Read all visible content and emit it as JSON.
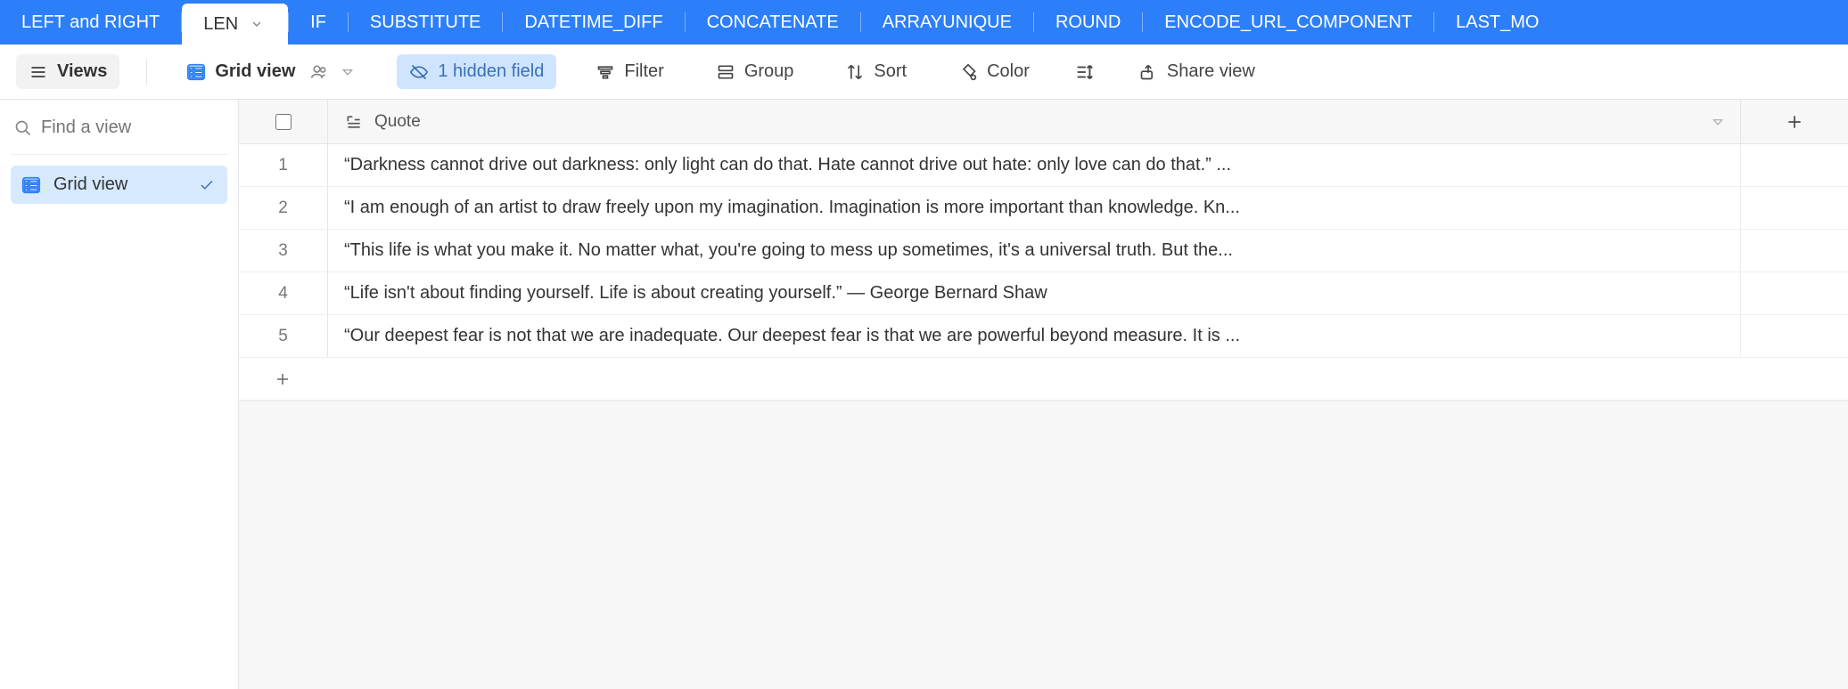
{
  "tabs": [
    {
      "label": "LEFT and RIGHT",
      "active": false
    },
    {
      "label": "LEN",
      "active": true
    },
    {
      "label": "IF",
      "active": false
    },
    {
      "label": "SUBSTITUTE",
      "active": false
    },
    {
      "label": "DATETIME_DIFF",
      "active": false
    },
    {
      "label": "CONCATENATE",
      "active": false
    },
    {
      "label": "ARRAYUNIQUE",
      "active": false
    },
    {
      "label": "ROUND",
      "active": false
    },
    {
      "label": "ENCODE_URL_COMPONENT",
      "active": false
    },
    {
      "label": "LAST_MO",
      "active": false
    }
  ],
  "toolbar": {
    "views": "Views",
    "grid_view": "Grid view",
    "hidden_field": "1 hidden field",
    "filter": "Filter",
    "group": "Group",
    "sort": "Sort",
    "color": "Color",
    "share": "Share view"
  },
  "sidebar": {
    "search_placeholder": "Find a view",
    "views": [
      {
        "label": "Grid view",
        "active": true
      }
    ]
  },
  "grid": {
    "column_header": "Quote",
    "rows": [
      {
        "n": "1",
        "text": "“Darkness cannot drive out darkness: only light can do that. Hate cannot drive out hate: only love can do that.” ..."
      },
      {
        "n": "2",
        "text": "“I am enough of an artist to draw freely upon my imagination. Imagination is more important than knowledge. Kn..."
      },
      {
        "n": "3",
        "text": "“This life is what you make it. No matter what, you're going to mess up sometimes, it's a universal truth. But the..."
      },
      {
        "n": "4",
        "text": "“Life isn't about finding yourself. Life is about creating yourself.” ― George Bernard Shaw"
      },
      {
        "n": "5",
        "text": "“Our deepest fear is not that we are inadequate. Our deepest fear is that we are powerful beyond measure. It is ..."
      }
    ]
  }
}
